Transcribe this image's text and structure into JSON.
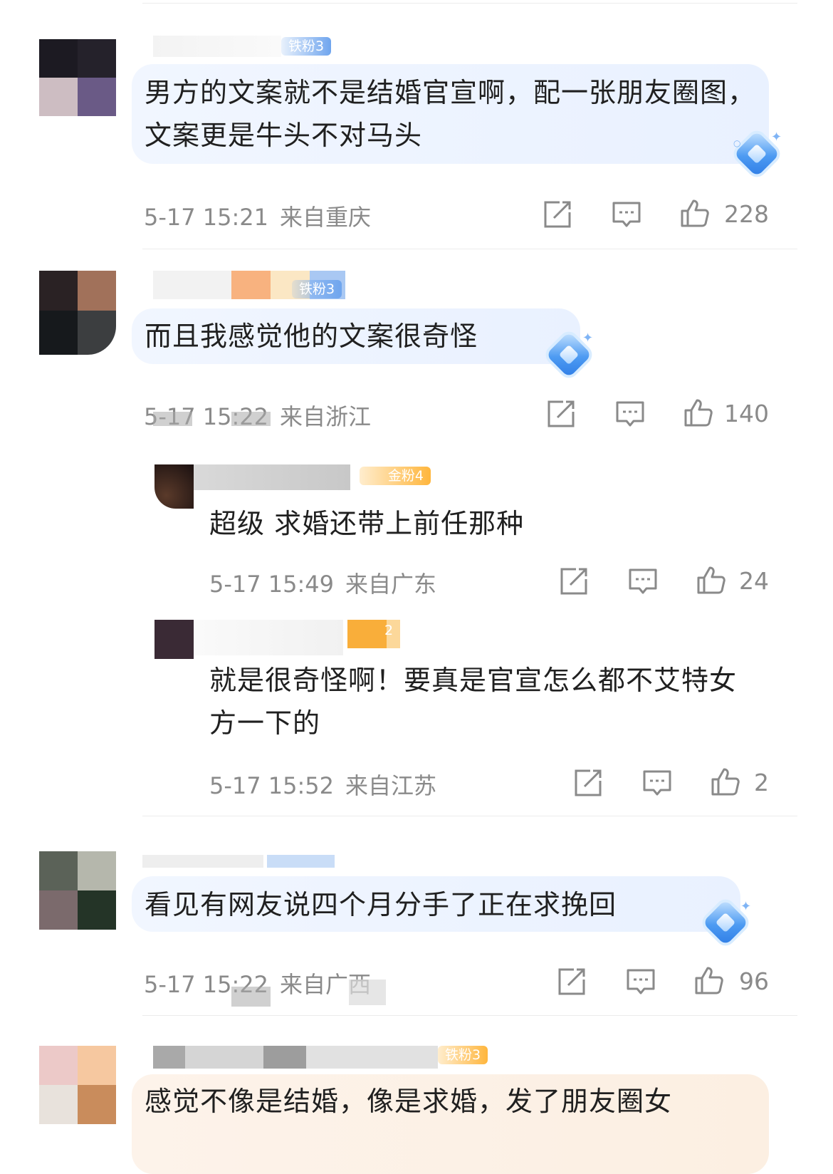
{
  "comments": [
    {
      "badge": "铁粉3",
      "text": "男方的文案就不是结婚官宣啊，配一张朋友圈图，文案更是牛头不对马头",
      "time": "5-17 15:21",
      "location": "来自重庆",
      "likes": "228"
    },
    {
      "badge": "铁粉3",
      "text": "而且我感觉他的文案很奇怪",
      "time": "5-17 15:22",
      "location": "来自浙江",
      "likes": "140",
      "replies": [
        {
          "badge": "金粉4",
          "text": "超级 求婚还带上前任那种",
          "time": "5-17 15:49",
          "location": "来自广东",
          "likes": "24"
        },
        {
          "badge": "2",
          "text": "就是很奇怪啊！要真是官宣怎么都不艾特女方一下的",
          "time": "5-17 15:52",
          "location": "来自江苏",
          "likes": "2"
        }
      ]
    },
    {
      "text": "看见有网友说四个月分手了正在求挽回",
      "time": "5-17 15:22",
      "location": "来自广西",
      "likes": "96"
    },
    {
      "badge": "铁粉3",
      "text": "感觉不像是结婚，像是求婚，发了朋友圈女"
    }
  ],
  "icons": {
    "share": "share-icon",
    "comment": "comment-icon",
    "like": "thumbs-up-icon",
    "verified": "diamond-gem-icon"
  },
  "colors": {
    "badge_blue": "#6fa5ee",
    "badge_gold": "#ffb63d",
    "bubble_blue": "#eef4ff",
    "meta_gray": "#8a8a8a"
  }
}
